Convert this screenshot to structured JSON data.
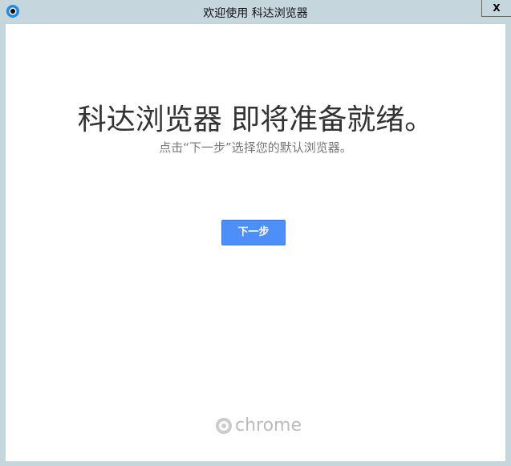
{
  "window": {
    "title": "欢迎使用 科达浏览器",
    "close_label": "X"
  },
  "main": {
    "heading": "科达浏览器 即将准备就绪。",
    "subtitle": "点击“下一步”选择您的默认浏览器。",
    "next_button": "下一步",
    "brand": "chrome"
  }
}
